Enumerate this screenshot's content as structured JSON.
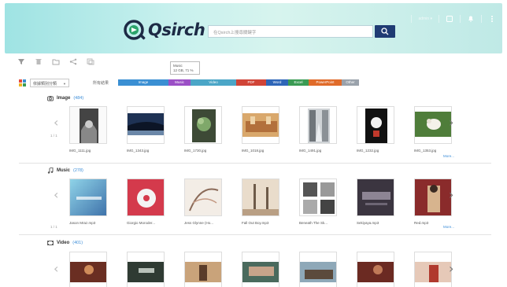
{
  "header": {
    "logo_text": "Qsirch",
    "search_placeholder": "在Qsirch上搜尋關鍵字",
    "user_label": "admin ▾",
    "icons": [
      "device-icon",
      "bell-icon",
      "more-vertical-icon"
    ]
  },
  "toolbar": {
    "icons": [
      "filter-icon",
      "delete-icon",
      "folder-icon",
      "share-icon",
      "copy-icon"
    ],
    "tooltip_line1": "Music",
    "tooltip_line2": "12 GB, 71 %"
  },
  "filter": {
    "sort_value": "依據類別分類",
    "label": "所有結果",
    "chips": [
      {
        "label": "Image",
        "color": "#3a8fd3",
        "width": 64
      },
      {
        "label": "Music",
        "color": "#9b4fc6",
        "width": 28
      },
      {
        "label": "Video",
        "color": "#4ba6c7",
        "width": 58
      },
      {
        "label": "PDF",
        "color": "#d04437",
        "width": 38
      },
      {
        "label": "Word",
        "color": "#2e66b8",
        "width": 28
      },
      {
        "label": "Excel",
        "color": "#3a9b54",
        "width": 26
      },
      {
        "label": "PowerPoint",
        "color": "#e06b2a",
        "width": 42
      },
      {
        "label": "Other",
        "color": "#9aa2ab",
        "width": 22
      }
    ]
  },
  "sections": {
    "image": {
      "title": "Image",
      "count": "(484)",
      "pager": "1 / 1",
      "more": "More...",
      "items": [
        "IMG_1111.jpg",
        "IMG_1343.jpg",
        "IMG_1730.jpg",
        "IMG_1018.jpg",
        "IMG_1491.jpg",
        "IMG_1232.jpg",
        "IMG_1353.jpg"
      ]
    },
    "music": {
      "title": "Music",
      "count": "(278)",
      "pager": "1 / 1",
      "more": "More...",
      "items": [
        "Jason Mraz.mp3",
        "Giorgio Moroder...",
        "Jess Glynne (Ho...",
        "Fall Out Boy.mp3",
        "Beneath The Sk...",
        "Sekiyaya.mp3",
        "Red.mp3"
      ]
    },
    "video": {
      "title": "Video",
      "count": "(401)"
    }
  },
  "colors": {
    "accent": "#1f3b73",
    "link": "#3d8ed8"
  }
}
